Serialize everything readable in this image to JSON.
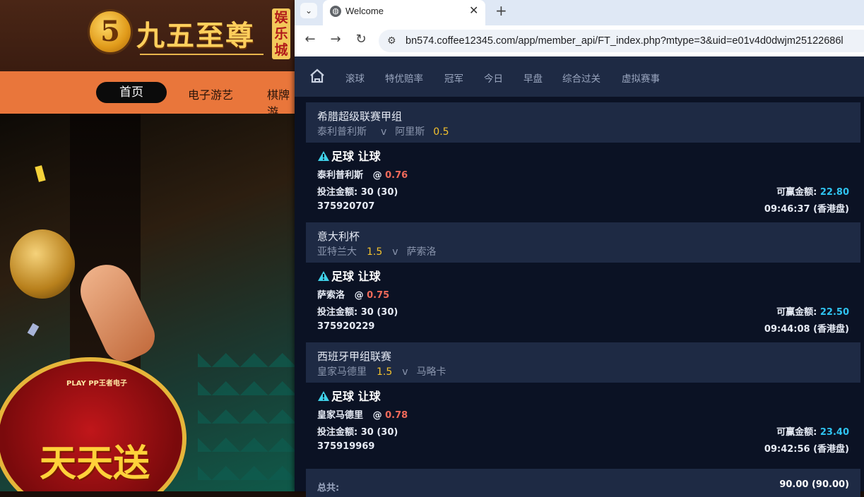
{
  "background_site": {
    "logo_digit": "5",
    "logo_title": "九五至尊",
    "logo_sub": "娱乐城",
    "nav": [
      "首页",
      "电子游艺",
      "棋牌游"
    ],
    "badge_logo": "PLAY PP王者电子",
    "badge_text": "天天送"
  },
  "browser": {
    "tab_title": "Welcome",
    "url": "bn574.coffee12345.com/app/member_api/FT_index.php?mtype=3&uid=e01v4d0dwjm25122686l"
  },
  "topnav": {
    "items": [
      "滚球",
      "特优赔率",
      "冠军",
      "今日",
      "早盘",
      "综合过关",
      "虚拟赛事"
    ]
  },
  "labels": {
    "stake_label": "投注金额:",
    "win_label": "可赢金额:",
    "total_label": "总共:",
    "vs": "v",
    "at": "@"
  },
  "bets": [
    {
      "league": "希腊超级联赛甲组",
      "home": "泰利普利斯",
      "home_hdp": "",
      "away": "阿里斯",
      "away_hdp": "0.5",
      "bet_type": "足球 让球",
      "pick": "泰利普利斯",
      "odds": "0.76",
      "stake": "30 (30)",
      "win": "22.80",
      "ticket": "375920707",
      "time": "09:46:37 (香港盘)"
    },
    {
      "league": "意大利杯",
      "home": "亚特兰大",
      "home_hdp": "1.5",
      "away": "萨索洛",
      "away_hdp": "",
      "bet_type": "足球 让球",
      "pick": "萨索洛",
      "odds": "0.75",
      "stake": "30 (30)",
      "win": "22.50",
      "ticket": "375920229",
      "time": "09:44:08 (香港盘)"
    },
    {
      "league": "西班牙甲组联赛",
      "home": "皇家马德里",
      "home_hdp": "1.5",
      "away": "马略卡",
      "away_hdp": "",
      "bet_type": "足球 让球",
      "pick": "皇家马德里",
      "odds": "0.78",
      "stake": "30 (30)",
      "win": "23.40",
      "ticket": "375919969",
      "time": "09:42:56 (香港盘)"
    }
  ],
  "total": "90.00 (90.00)",
  "colors": {
    "accent_odds": "#f16a5a",
    "accent_win": "#2fc3f0",
    "accent_handicap": "#f2c12e"
  }
}
